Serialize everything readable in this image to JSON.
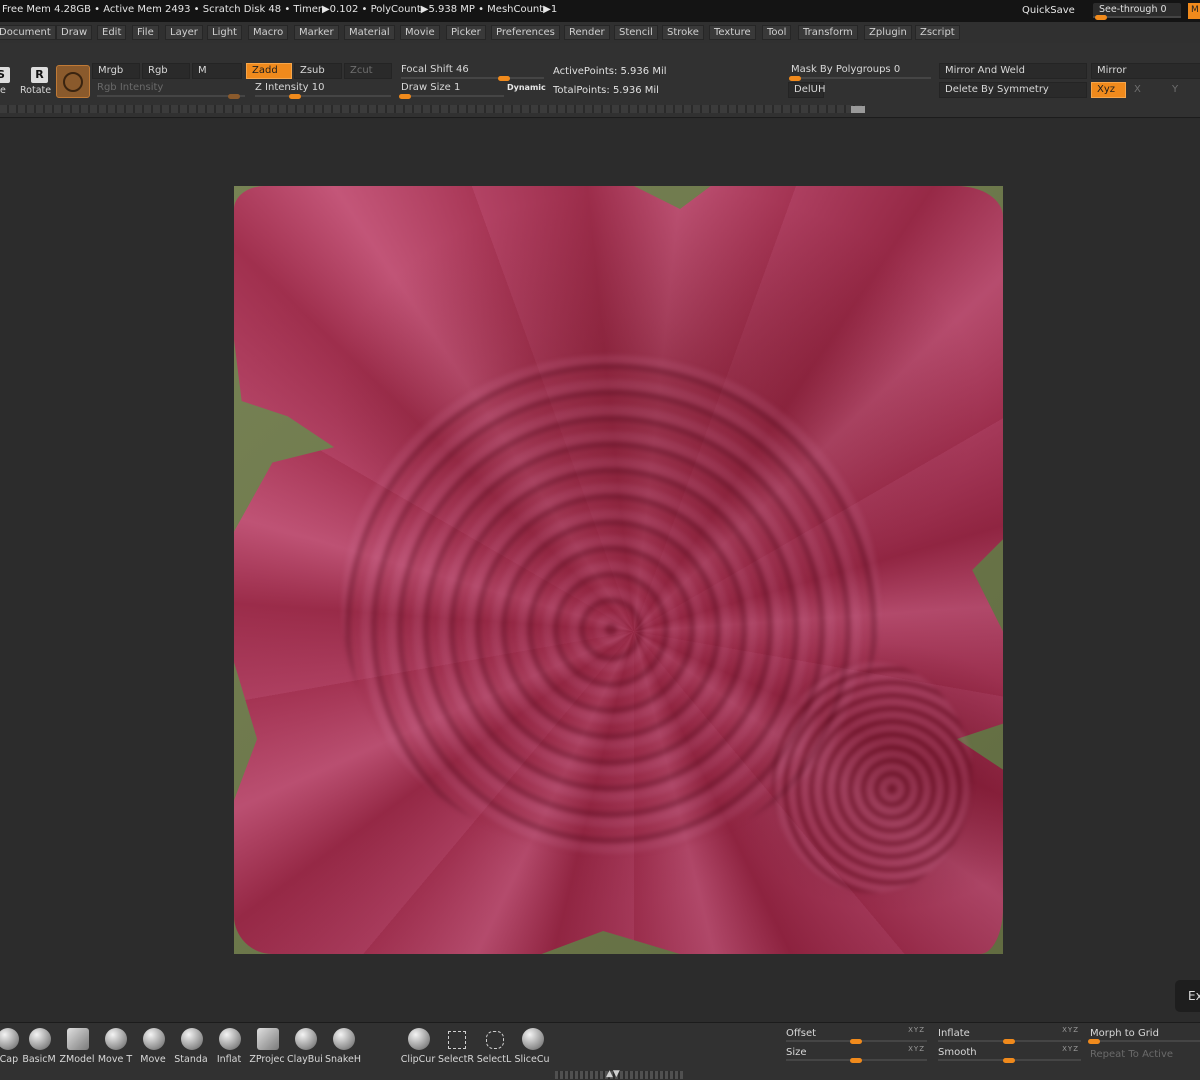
{
  "status": {
    "text": "Free Mem 4.28GB • Active Mem 2493 • Scratch Disk 48 • Timer▶0.102 • PolyCount▶5.938 MP • MeshCount▶1",
    "quicksave": "QuickSave",
    "see_through": "See-through  0",
    "see_through_value": 0,
    "corner_label": "M"
  },
  "menu": [
    "Document",
    "Draw",
    "Edit",
    "File",
    "Layer",
    "Light",
    "Macro",
    "Marker",
    "Material",
    "Movie",
    "Picker",
    "Preferences",
    "Render",
    "Stencil",
    "Stroke",
    "Texture",
    "Tool",
    "Transform",
    "Zplugin",
    "Zscript"
  ],
  "shelf": {
    "scale_icon": "S",
    "rotate_icon": "R",
    "rotate_label": "Rotate",
    "scale_label_fragment": "e",
    "mrgb": "Mrgb",
    "rgb": "Rgb",
    "m": "M",
    "zadd": "Zadd",
    "zsub": "Zsub",
    "zcut": "Zcut",
    "rgb_intensity": "Rgb Intensity",
    "z_intensity": "Z Intensity 10",
    "z_intensity_value": 10,
    "focal_shift": "Focal Shift 46",
    "focal_shift_value": 46,
    "draw_size": "Draw Size 1",
    "draw_size_value": 1,
    "dynamic": "Dynamic",
    "active_points": "ActivePoints: 5.936 Mil",
    "total_points": "TotalPoints: 5.936 Mil",
    "mask_by_polygroups": "Mask By Polygroups 0",
    "mask_by_polygroups_value": 0,
    "deluh": "DelUH",
    "mirror_and_weld": "Mirror And Weld",
    "delete_by_symmetry": "Delete By Symmetry",
    "mirror": "Mirror",
    "xyz": "Xyz",
    "x": "X",
    "y": "Y"
  },
  "canvas": {
    "exit_label": "Ex"
  },
  "brushes": [
    "tCap",
    "BasicM",
    "ZModel",
    "Move T",
    "Move",
    "Standa",
    "Inflat",
    "ZProjec",
    "ClayBui",
    "SnakeH"
  ],
  "tools": [
    "ClipCur",
    "SelectR",
    "SelectL",
    "SliceCu"
  ],
  "bottom_sliders": {
    "offset": "Offset",
    "size": "Size",
    "inflate": "Inflate",
    "smooth": "Smooth",
    "morph_to_grid": "Morph to Grid",
    "repeat_to_active": "Repeat To Active"
  },
  "colors": {
    "accent": "#f08a1c",
    "background": "#2b2b2b"
  }
}
